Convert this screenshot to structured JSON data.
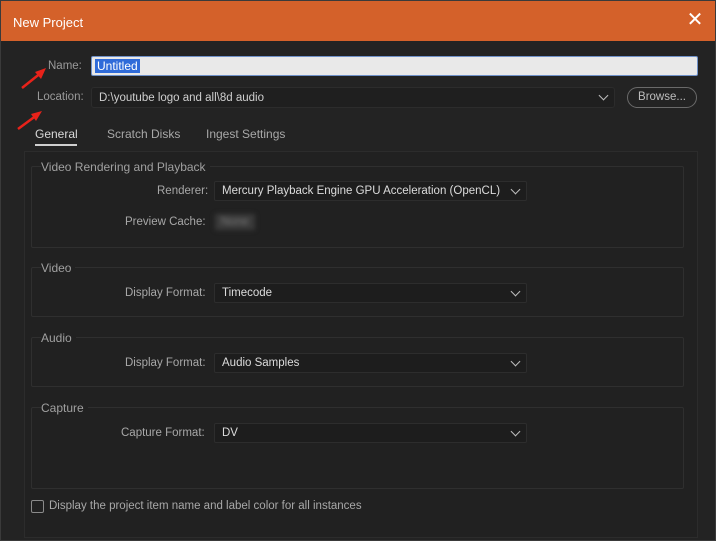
{
  "window": {
    "title": "New Project",
    "close_glyph": "✕"
  },
  "name_field": {
    "label": "Name:",
    "value": "Untitled"
  },
  "location": {
    "label": "Location:",
    "value": "D:\\youtube logo and all\\8d audio",
    "browse_label": "Browse..."
  },
  "tabs": [
    {
      "label": "General",
      "active": true
    },
    {
      "label": "Scratch Disks",
      "active": false
    },
    {
      "label": "Ingest Settings",
      "active": false
    }
  ],
  "sections": {
    "video_rendering": {
      "title": "Video Rendering and Playback",
      "renderer_label": "Renderer:",
      "renderer_value": "Mercury Playback Engine GPU Acceleration (OpenCL)",
      "preview_cache_label": "Preview Cache:",
      "preview_cache_value": "None"
    },
    "video": {
      "title": "Video",
      "display_format_label": "Display Format:",
      "display_format_value": "Timecode"
    },
    "audio": {
      "title": "Audio",
      "display_format_label": "Display Format:",
      "display_format_value": "Audio Samples"
    },
    "capture": {
      "title": "Capture",
      "capture_format_label": "Capture Format:",
      "capture_format_value": "DV"
    }
  },
  "checkbox": {
    "label": "Display the project item name and label color for all instances",
    "checked": false
  },
  "colors": {
    "titlebar": "#d4612a",
    "annotation_arrow": "#e8221a",
    "selection": "#2f6bd9"
  },
  "icons": {
    "close": "close-icon",
    "dropdown": "chevron-down-icon",
    "annotation": "red-arrow-icon"
  }
}
